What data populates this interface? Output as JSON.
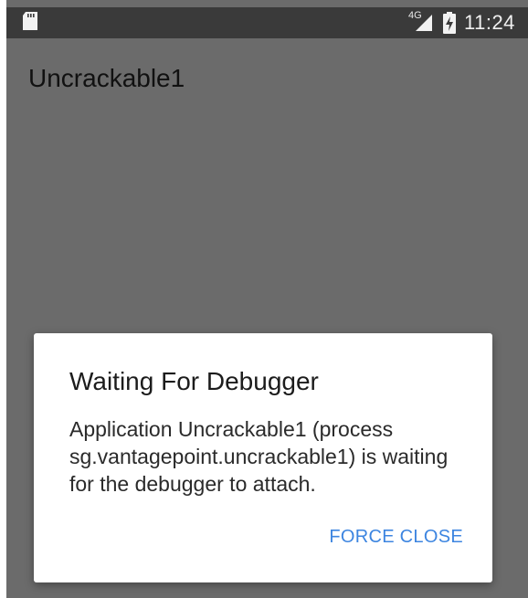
{
  "status_bar": {
    "network_type": "4G",
    "time": "11:24",
    "icons": [
      "sd-card-icon",
      "cellular-signal-icon",
      "battery-charging-icon"
    ]
  },
  "app": {
    "title": "Uncrackable1"
  },
  "dialog": {
    "title": "Waiting For Debugger",
    "message": "Application Uncrackable1 (process sg.vantagepoint.uncrackable1) is waiting for the debugger to attach.",
    "force_close_label": "FORCE CLOSE"
  },
  "colors": {
    "status_bar": "#3a3a3a",
    "dimmed_background": "#6b6b6b",
    "dialog_background": "#ffffff",
    "accent": "#3d85e0"
  }
}
